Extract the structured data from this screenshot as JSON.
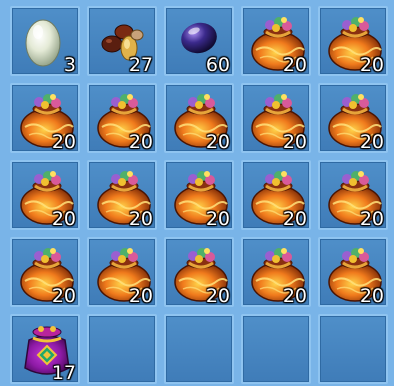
{
  "inventory": {
    "slots": [
      {
        "icon": "pearl-icon",
        "qty": "3"
      },
      {
        "icon": "beans-icon",
        "qty": "27"
      },
      {
        "icon": "purple-gem-icon",
        "qty": "60"
      },
      {
        "icon": "treasure-pouch-icon",
        "qty": "20"
      },
      {
        "icon": "treasure-pouch-icon",
        "qty": "20"
      },
      {
        "icon": "treasure-pouch-icon",
        "qty": "20"
      },
      {
        "icon": "treasure-pouch-icon",
        "qty": "20"
      },
      {
        "icon": "treasure-pouch-icon",
        "qty": "20"
      },
      {
        "icon": "treasure-pouch-icon",
        "qty": "20"
      },
      {
        "icon": "treasure-pouch-icon",
        "qty": "20"
      },
      {
        "icon": "treasure-pouch-icon",
        "qty": "20"
      },
      {
        "icon": "treasure-pouch-icon",
        "qty": "20"
      },
      {
        "icon": "treasure-pouch-icon",
        "qty": "20"
      },
      {
        "icon": "treasure-pouch-icon",
        "qty": "20"
      },
      {
        "icon": "treasure-pouch-icon",
        "qty": "20"
      },
      {
        "icon": "treasure-pouch-icon",
        "qty": "20"
      },
      {
        "icon": "treasure-pouch-icon",
        "qty": "20"
      },
      {
        "icon": "treasure-pouch-icon",
        "qty": "20"
      },
      {
        "icon": "treasure-pouch-icon",
        "qty": "20"
      },
      {
        "icon": "treasure-pouch-icon",
        "qty": "20"
      },
      {
        "icon": "purple-gift-bag-icon",
        "qty": "17"
      },
      {
        "icon": "",
        "qty": ""
      },
      {
        "icon": "",
        "qty": ""
      },
      {
        "icon": "",
        "qty": ""
      },
      {
        "icon": "",
        "qty": ""
      }
    ]
  },
  "colors": {
    "background": "#79b4e8",
    "slot": "#4682bf",
    "slot_border": "#8fc4f0",
    "pouch_orange": "#e8641a",
    "gift_bag_purple": "#8e1aa6"
  }
}
